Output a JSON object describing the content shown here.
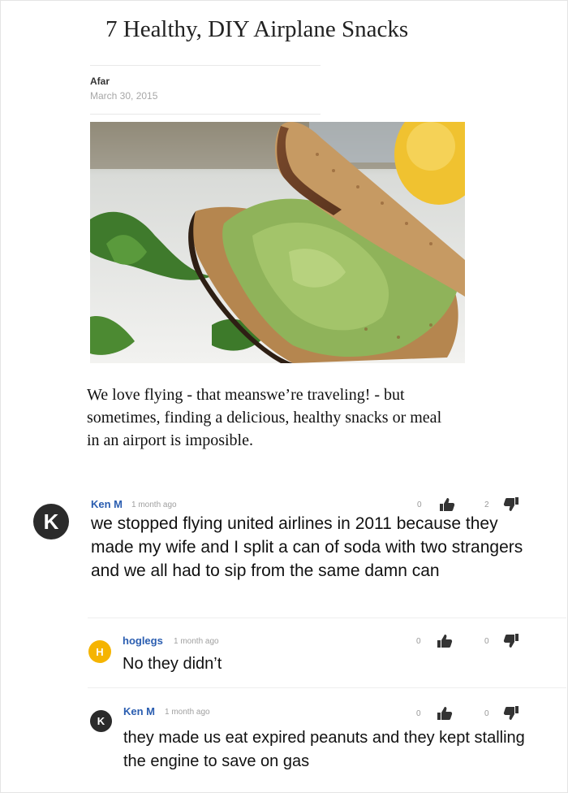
{
  "article": {
    "title": "7 Healthy, DIY Airplane Snacks",
    "author": "Afar",
    "date": "March 30, 2015",
    "image_alt": "avocado sandwich",
    "intro": "We love flying - that meanswe’re traveling! - but sometimes, finding a delicious, healthy snacks or meal in an airport is imposible."
  },
  "comments": [
    {
      "avatar_letter": "K",
      "avatar_color": "#2b2b2b",
      "author": "Ken M",
      "time": "1 month ago",
      "upvotes": "0",
      "downvotes": "2",
      "text": "we stopped flying united airlines in 2011 because they made my wife and I split a can of soda with two strangers and we all had to sip from the same damn can"
    },
    {
      "avatar_letter": "H",
      "avatar_color": "#f5b400",
      "author": "hoglegs",
      "time": "1 month ago",
      "upvotes": "0",
      "downvotes": "0",
      "text": "No they didn’t"
    },
    {
      "avatar_letter": "K",
      "avatar_color": "#2b2b2b",
      "author": "Ken M",
      "time": "1 month ago",
      "upvotes": "0",
      "downvotes": "0",
      "text": "they made us eat expired peanuts and they kept stalling the engine to save on gas"
    }
  ],
  "icons": {
    "upvote": "thumbs-up-icon",
    "downvote": "thumbs-down-icon"
  }
}
